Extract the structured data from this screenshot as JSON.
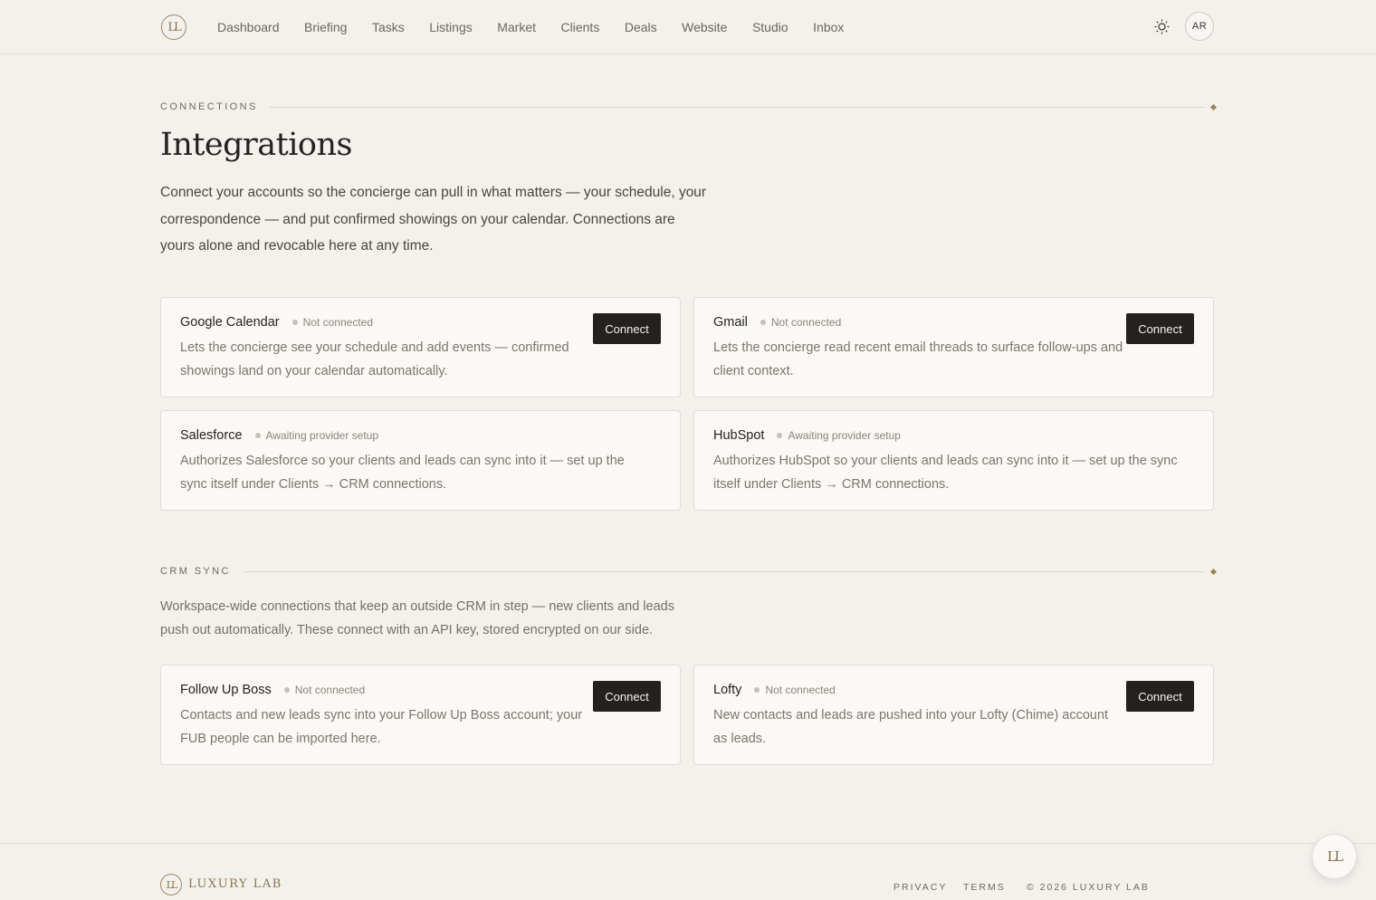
{
  "brand": {
    "monogram": "LL",
    "name": "LUXURY LAB"
  },
  "nav": {
    "items": [
      "Dashboard",
      "Briefing",
      "Tasks",
      "Listings",
      "Market",
      "Clients",
      "Deals",
      "Website",
      "Studio",
      "Inbox"
    ]
  },
  "header": {
    "theme_icon": "sun-icon",
    "avatar_initials": "AR"
  },
  "connections": {
    "eyebrow": "CONNECTIONS",
    "title": "Integrations",
    "lead": "Connect your accounts so the concierge can pull in what matters — your schedule, your correspondence — and put confirmed showings on your calendar. Connections are yours alone and revocable here at any time.",
    "cards": [
      {
        "name": "Google Calendar",
        "status": "Not connected",
        "desc": "Lets the concierge see your schedule and add events — confirmed showings land on your calendar automatically.",
        "action": "Connect"
      },
      {
        "name": "Gmail",
        "status": "Not connected",
        "desc": "Lets the concierge read recent email threads to surface follow-ups and client context.",
        "action": "Connect"
      },
      {
        "name": "Salesforce",
        "status": "Awaiting provider setup",
        "desc": "Authorizes Salesforce so your clients and leads can sync into it — set up the sync itself under Clients → CRM connections."
      },
      {
        "name": "HubSpot",
        "status": "Awaiting provider setup",
        "desc": "Authorizes HubSpot so your clients and leads can sync into it — set up the sync itself under Clients → CRM connections."
      }
    ]
  },
  "crm_sync": {
    "eyebrow": "CRM SYNC",
    "desc": "Workspace-wide connections that keep an outside CRM in step — new clients and leads push out automatically. These connect with an API key, stored encrypted on our side.",
    "cards": [
      {
        "name": "Follow Up Boss",
        "status": "Not connected",
        "desc": "Contacts and new leads sync into your Follow Up Boss account; your FUB people can be imported here.",
        "action": "Connect"
      },
      {
        "name": "Lofty",
        "status": "Not connected",
        "desc": "New contacts and leads are pushed into your Lofty (Chime) account as leads.",
        "action": "Connect"
      }
    ]
  },
  "footer": {
    "privacy": "PRIVACY",
    "terms": "TERMS",
    "copyright": "© 2026 LUXURY LAB"
  },
  "colors": {
    "accent": "#a08155",
    "background": "#f3f1ec",
    "button": "#24221f",
    "card": "#faf9f6"
  }
}
